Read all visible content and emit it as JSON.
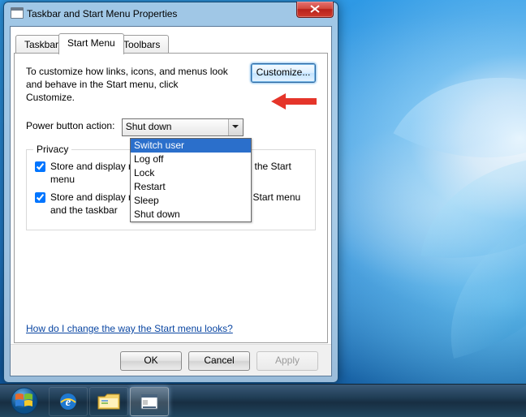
{
  "window": {
    "title": "Taskbar and Start Menu Properties",
    "tabs": [
      "Taskbar",
      "Start Menu",
      "Toolbars"
    ],
    "active_tab": 1,
    "desc": "To customize how links, icons, and menus look and behave in the Start menu, click Customize.",
    "customize_label": "Customize...",
    "power_label": "Power button action:",
    "power_value": "Shut down",
    "power_options": [
      "Switch user",
      "Log off",
      "Lock",
      "Restart",
      "Sleep",
      "Shut down"
    ],
    "power_highlight_index": 0,
    "group_legend": "Privacy",
    "chk1_label": "Store and display recently opened programs in the Start menu",
    "chk1_checked": true,
    "chk2_label": "Store and display recently opened items in the Start menu and the taskbar",
    "chk2_checked": true,
    "help_link": "How do I change the way the Start menu looks?",
    "buttons": {
      "ok": "OK",
      "cancel": "Cancel",
      "apply": "Apply"
    },
    "apply_enabled": false
  },
  "annotation": {
    "arrow_color": "#e5352a"
  },
  "taskbar": {
    "start": "Start",
    "pinned": [
      {
        "name": "internet-explorer",
        "letter": "e"
      },
      {
        "name": "file-explorer"
      },
      {
        "name": "taskbar-properties",
        "active": true
      }
    ]
  }
}
